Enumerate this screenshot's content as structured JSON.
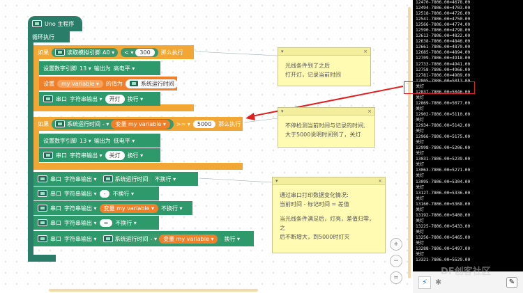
{
  "blocks": {
    "main": "Uno 主程序",
    "loop": "循环执行",
    "if1": {
      "label": "如果",
      "read": "读取模拟引脚",
      "pin": "A0",
      "op": "<",
      "value": "300",
      "then": "那么执行"
    },
    "dig1": {
      "label": "设置数字引脚",
      "pin": "13",
      "out": "输出为",
      "level": "高电平"
    },
    "setvar": {
      "label": "设置",
      "var": "my variable",
      "assign": "的值为",
      "time": "系统运行时间"
    },
    "print1": {
      "serial": "串口",
      "mode": "字符串输出",
      "text": "开灯",
      "nl": "换行"
    },
    "if2": {
      "label": "如果",
      "time": "系统运行时间",
      "minus": "-",
      "var": "变量 my variable",
      "op": ">=",
      "value": "5000",
      "then": "那么执行"
    },
    "dig2": {
      "label": "设置数字引脚",
      "pin": "13",
      "out": "输出为",
      "level": "低电平"
    },
    "print2": {
      "serial": "串口",
      "mode": "字符串输出",
      "text": "关灯",
      "nl": "换行"
    },
    "p3": {
      "serial": "串口",
      "mode": "字符串输出",
      "time": "系统运行时间",
      "nl": "不换行"
    },
    "p4": {
      "serial": "串口",
      "mode": "字符串输出",
      "text": "-",
      "nl": "不换行"
    },
    "p5": {
      "serial": "串口",
      "mode": "字符串输出",
      "var": "变量 my variable",
      "nl": "不换行"
    },
    "p6": {
      "serial": "串口",
      "mode": "字符串输出",
      "text": "=",
      "nl": "不换行"
    },
    "p7": {
      "serial": "串口",
      "mode": "字符串输出",
      "time": "系统运行时间",
      "minus": "-",
      "var": "变量 my variable",
      "nl": "换行"
    }
  },
  "notes": {
    "n1": {
      "lines": [
        "光线条件到了之后",
        "打开灯，记录当前时间"
      ]
    },
    "n2": {
      "lines": [
        "不停检测当前时间与记录的时间,",
        "大于5000说明时间到了，关灯"
      ]
    },
    "n3": {
      "lines": [
        "通过串口打印数据变化情况:",
        "当前时间 - 标记时间 = 差值",
        "",
        "当光线条件满足后，灯亮，差值归零，之",
        "后不断增大，到5000时灯灭"
      ]
    },
    "close": "×",
    "collapse": "▾"
  },
  "console": [
    "12470-7806.00=4678.00",
    "12494-7806.00=4703.00",
    "12518-7806.00=4726.00",
    "12541-7806.00=4750.00",
    "12566-7806.00=4774.00",
    "12590-7806.00=4798.00",
    "12613-7806.00=4822.00",
    "12638-7806.00=4846.00",
    "12661-7806.00=4870.00",
    "12685-7806.00=4894.00",
    "12709-7806.00=4918.00",
    "12733-7806.00=4941.00",
    "12758-7806.00=4966.00",
    "12781-7806.00=4989.00",
    "12805-7806.00=5013.00",
    "关灯",
    "12837-7806.00=5046.00",
    "关灯",
    "12869-7806.00=5077.00",
    "关灯",
    "12902-7806.00=5110.00",
    "关灯",
    "12934-7806.00=5142.00",
    "关灯",
    "12966-7806.00=5175.00",
    "关灯",
    "12998-7806.00=5206.00",
    "关灯",
    "13031-7806.00=5239.00",
    "关灯",
    "13063-7806.00=5271.00",
    "关灯",
    "13095-7806.00=5304.00",
    "关灯",
    "13127-7806.00=5336.00",
    "关灯",
    "13160-7806.00=5368.00",
    "关灯",
    "13192-7806.00=5400.00",
    "关灯",
    "13225-7806.00=5433.00",
    "关灯",
    "13256-7806.00=5465.00",
    "关灯",
    "13288-7806.00=5497.00",
    "关灯",
    "13321-7806.00=5529.00"
  ],
  "zoom": {
    "in": "+",
    "out": "−",
    "reset": "="
  },
  "watermark": "DF创客社区"
}
